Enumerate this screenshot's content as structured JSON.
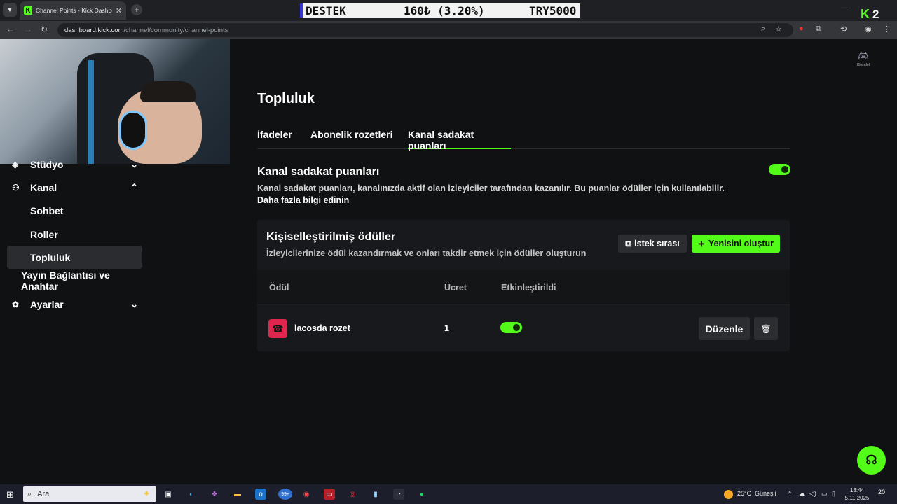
{
  "browser": {
    "tab_title": "Channel Points - Kick Dashboar",
    "tab_close": "✕",
    "new_tab": "+",
    "url_host": "dashboard.kick.com",
    "url_path": "/channel/community/channel-points"
  },
  "ticker": {
    "label": "DESTEK",
    "amount": "160₺ (3.20%)",
    "goal": "TRY5000"
  },
  "overlay": {
    "logo_letter": "K",
    "count": "2"
  },
  "sidebar": {
    "items": [
      {
        "label": "Stüdyo",
        "icon": "studio-icon"
      },
      {
        "label": "Kanal",
        "icon": "channel-icon"
      },
      {
        "label": "Sohbet"
      },
      {
        "label": "Roller"
      },
      {
        "label": "Topluluk"
      },
      {
        "label": "Yayın Bağlantısı ve Anahtar"
      },
      {
        "label": "Ayarlar",
        "icon": "gear-icon"
      }
    ]
  },
  "user": {
    "name": "Kleimfel"
  },
  "main": {
    "title": "Topluluk",
    "tabs": [
      "İfadeler",
      "Abonelik rozetleri",
      "Kanal sadakat puanları"
    ],
    "active_tab": "Kanal sadakat puanları",
    "section_title": "Kanal sadakat puanları",
    "section_desc": "Kanal sadakat puanları, kanalınızda aktif olan izleyiciler tarafından kazanılır. Bu puanlar ödüller için kullanılabilir.",
    "learn_more": "Daha fazla bilgi edinin",
    "points_enabled": true
  },
  "rewards_card": {
    "title": "Kişiselleştirilmiş ödüller",
    "subtitle": "İzleyicilerinize ödül kazandırmak ve onları takdir etmek için ödüller oluşturun",
    "queue_button": "İstek sırası",
    "create_button": "Yenisini oluştur",
    "columns": [
      "Ödül",
      "Ücret",
      "Etkinleştirildi"
    ],
    "rows": [
      {
        "name": "lacosda rozet",
        "cost": "1",
        "enabled": true
      }
    ],
    "edit_button": "Düzenle"
  },
  "taskbar": {
    "search_placeholder": "Ara",
    "badge": "99+",
    "weather_temp": "25°C",
    "weather_desc": "Güneşli",
    "time": "13:44",
    "date": "5.11.2025",
    "notifications": "20"
  },
  "colors": {
    "accent": "#53fc18",
    "background": "#101113",
    "card": "#18191c",
    "reward_icon": "#e0254e"
  }
}
